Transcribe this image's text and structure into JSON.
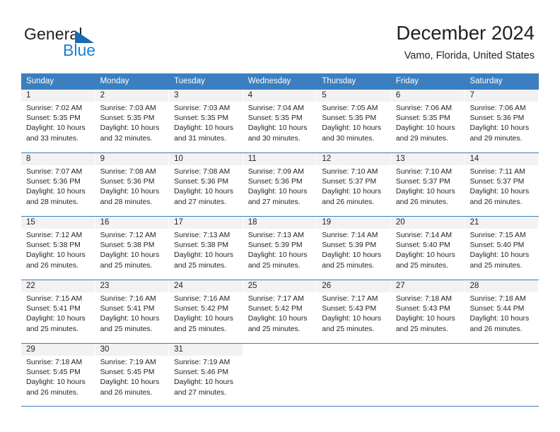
{
  "brand": {
    "name_top": "General",
    "name_bottom": "Blue",
    "accent_color": "#1f7fd0",
    "triangle_color": "#1a6ab4"
  },
  "header": {
    "title": "December 2024",
    "location": "Vamo, Florida, United States"
  },
  "calendar": {
    "header_bg": "#3c7fc0",
    "header_text_color": "#ffffff",
    "daynum_band_bg": "#f2f2f2",
    "weekday_names": [
      "Sunday",
      "Monday",
      "Tuesday",
      "Wednesday",
      "Thursday",
      "Friday",
      "Saturday"
    ],
    "weeks": [
      [
        {
          "day": "1",
          "sunrise": "Sunrise: 7:02 AM",
          "sunset": "Sunset: 5:35 PM",
          "daylight1": "Daylight: 10 hours",
          "daylight2": "and 33 minutes."
        },
        {
          "day": "2",
          "sunrise": "Sunrise: 7:03 AM",
          "sunset": "Sunset: 5:35 PM",
          "daylight1": "Daylight: 10 hours",
          "daylight2": "and 32 minutes."
        },
        {
          "day": "3",
          "sunrise": "Sunrise: 7:03 AM",
          "sunset": "Sunset: 5:35 PM",
          "daylight1": "Daylight: 10 hours",
          "daylight2": "and 31 minutes."
        },
        {
          "day": "4",
          "sunrise": "Sunrise: 7:04 AM",
          "sunset": "Sunset: 5:35 PM",
          "daylight1": "Daylight: 10 hours",
          "daylight2": "and 30 minutes."
        },
        {
          "day": "5",
          "sunrise": "Sunrise: 7:05 AM",
          "sunset": "Sunset: 5:35 PM",
          "daylight1": "Daylight: 10 hours",
          "daylight2": "and 30 minutes."
        },
        {
          "day": "6",
          "sunrise": "Sunrise: 7:06 AM",
          "sunset": "Sunset: 5:35 PM",
          "daylight1": "Daylight: 10 hours",
          "daylight2": "and 29 minutes."
        },
        {
          "day": "7",
          "sunrise": "Sunrise: 7:06 AM",
          "sunset": "Sunset: 5:36 PM",
          "daylight1": "Daylight: 10 hours",
          "daylight2": "and 29 minutes."
        }
      ],
      [
        {
          "day": "8",
          "sunrise": "Sunrise: 7:07 AM",
          "sunset": "Sunset: 5:36 PM",
          "daylight1": "Daylight: 10 hours",
          "daylight2": "and 28 minutes."
        },
        {
          "day": "9",
          "sunrise": "Sunrise: 7:08 AM",
          "sunset": "Sunset: 5:36 PM",
          "daylight1": "Daylight: 10 hours",
          "daylight2": "and 28 minutes."
        },
        {
          "day": "10",
          "sunrise": "Sunrise: 7:08 AM",
          "sunset": "Sunset: 5:36 PM",
          "daylight1": "Daylight: 10 hours",
          "daylight2": "and 27 minutes."
        },
        {
          "day": "11",
          "sunrise": "Sunrise: 7:09 AM",
          "sunset": "Sunset: 5:36 PM",
          "daylight1": "Daylight: 10 hours",
          "daylight2": "and 27 minutes."
        },
        {
          "day": "12",
          "sunrise": "Sunrise: 7:10 AM",
          "sunset": "Sunset: 5:37 PM",
          "daylight1": "Daylight: 10 hours",
          "daylight2": "and 26 minutes."
        },
        {
          "day": "13",
          "sunrise": "Sunrise: 7:10 AM",
          "sunset": "Sunset: 5:37 PM",
          "daylight1": "Daylight: 10 hours",
          "daylight2": "and 26 minutes."
        },
        {
          "day": "14",
          "sunrise": "Sunrise: 7:11 AM",
          "sunset": "Sunset: 5:37 PM",
          "daylight1": "Daylight: 10 hours",
          "daylight2": "and 26 minutes."
        }
      ],
      [
        {
          "day": "15",
          "sunrise": "Sunrise: 7:12 AM",
          "sunset": "Sunset: 5:38 PM",
          "daylight1": "Daylight: 10 hours",
          "daylight2": "and 26 minutes."
        },
        {
          "day": "16",
          "sunrise": "Sunrise: 7:12 AM",
          "sunset": "Sunset: 5:38 PM",
          "daylight1": "Daylight: 10 hours",
          "daylight2": "and 25 minutes."
        },
        {
          "day": "17",
          "sunrise": "Sunrise: 7:13 AM",
          "sunset": "Sunset: 5:38 PM",
          "daylight1": "Daylight: 10 hours",
          "daylight2": "and 25 minutes."
        },
        {
          "day": "18",
          "sunrise": "Sunrise: 7:13 AM",
          "sunset": "Sunset: 5:39 PM",
          "daylight1": "Daylight: 10 hours",
          "daylight2": "and 25 minutes."
        },
        {
          "day": "19",
          "sunrise": "Sunrise: 7:14 AM",
          "sunset": "Sunset: 5:39 PM",
          "daylight1": "Daylight: 10 hours",
          "daylight2": "and 25 minutes."
        },
        {
          "day": "20",
          "sunrise": "Sunrise: 7:14 AM",
          "sunset": "Sunset: 5:40 PM",
          "daylight1": "Daylight: 10 hours",
          "daylight2": "and 25 minutes."
        },
        {
          "day": "21",
          "sunrise": "Sunrise: 7:15 AM",
          "sunset": "Sunset: 5:40 PM",
          "daylight1": "Daylight: 10 hours",
          "daylight2": "and 25 minutes."
        }
      ],
      [
        {
          "day": "22",
          "sunrise": "Sunrise: 7:15 AM",
          "sunset": "Sunset: 5:41 PM",
          "daylight1": "Daylight: 10 hours",
          "daylight2": "and 25 minutes."
        },
        {
          "day": "23",
          "sunrise": "Sunrise: 7:16 AM",
          "sunset": "Sunset: 5:41 PM",
          "daylight1": "Daylight: 10 hours",
          "daylight2": "and 25 minutes."
        },
        {
          "day": "24",
          "sunrise": "Sunrise: 7:16 AM",
          "sunset": "Sunset: 5:42 PM",
          "daylight1": "Daylight: 10 hours",
          "daylight2": "and 25 minutes."
        },
        {
          "day": "25",
          "sunrise": "Sunrise: 7:17 AM",
          "sunset": "Sunset: 5:42 PM",
          "daylight1": "Daylight: 10 hours",
          "daylight2": "and 25 minutes."
        },
        {
          "day": "26",
          "sunrise": "Sunrise: 7:17 AM",
          "sunset": "Sunset: 5:43 PM",
          "daylight1": "Daylight: 10 hours",
          "daylight2": "and 25 minutes."
        },
        {
          "day": "27",
          "sunrise": "Sunrise: 7:18 AM",
          "sunset": "Sunset: 5:43 PM",
          "daylight1": "Daylight: 10 hours",
          "daylight2": "and 25 minutes."
        },
        {
          "day": "28",
          "sunrise": "Sunrise: 7:18 AM",
          "sunset": "Sunset: 5:44 PM",
          "daylight1": "Daylight: 10 hours",
          "daylight2": "and 26 minutes."
        }
      ],
      [
        {
          "day": "29",
          "sunrise": "Sunrise: 7:18 AM",
          "sunset": "Sunset: 5:45 PM",
          "daylight1": "Daylight: 10 hours",
          "daylight2": "and 26 minutes."
        },
        {
          "day": "30",
          "sunrise": "Sunrise: 7:19 AM",
          "sunset": "Sunset: 5:45 PM",
          "daylight1": "Daylight: 10 hours",
          "daylight2": "and 26 minutes."
        },
        {
          "day": "31",
          "sunrise": "Sunrise: 7:19 AM",
          "sunset": "Sunset: 5:46 PM",
          "daylight1": "Daylight: 10 hours",
          "daylight2": "and 27 minutes."
        },
        {
          "day": "",
          "sunrise": "",
          "sunset": "",
          "daylight1": "",
          "daylight2": ""
        },
        {
          "day": "",
          "sunrise": "",
          "sunset": "",
          "daylight1": "",
          "daylight2": ""
        },
        {
          "day": "",
          "sunrise": "",
          "sunset": "",
          "daylight1": "",
          "daylight2": ""
        },
        {
          "day": "",
          "sunrise": "",
          "sunset": "",
          "daylight1": "",
          "daylight2": ""
        }
      ]
    ]
  }
}
